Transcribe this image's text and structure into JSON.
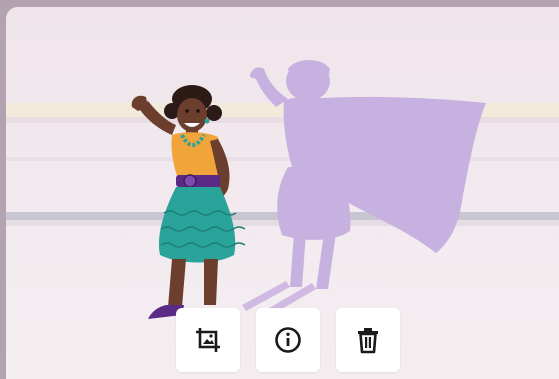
{
  "toolbar": {
    "buttons": [
      {
        "name": "crop-image-button",
        "icon": "crop-image-icon"
      },
      {
        "name": "info-button",
        "icon": "info-icon"
      },
      {
        "name": "delete-button",
        "icon": "trash-icon"
      }
    ]
  },
  "colors": {
    "background": "#ede4ea",
    "shadow": "#c9b2e0",
    "skin": "#6b3e2e",
    "top": "#f0a43a",
    "skirt": "#2aa39a",
    "belt": "#5b2a86"
  }
}
